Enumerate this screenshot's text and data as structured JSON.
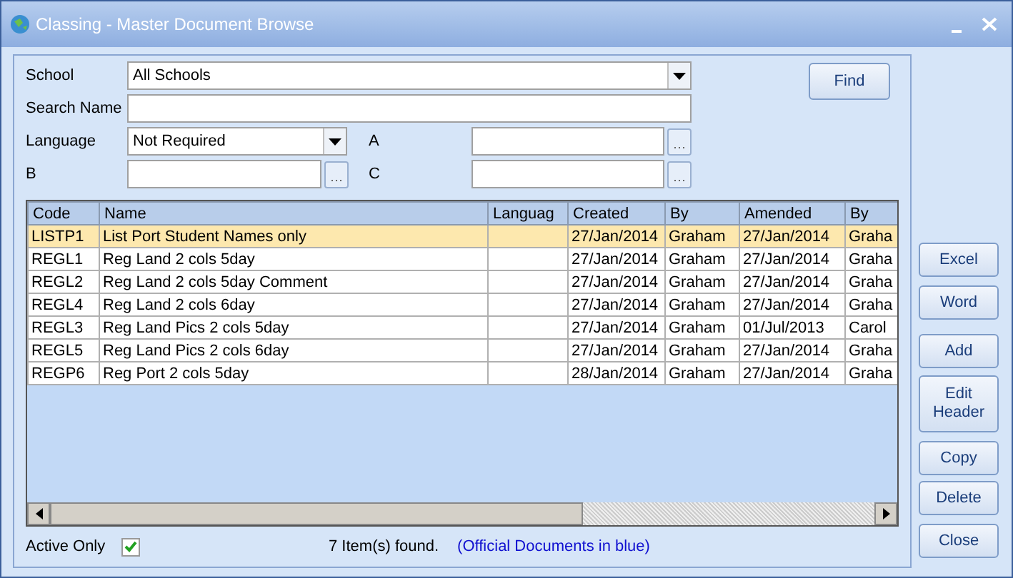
{
  "window": {
    "title": "Classing - Master Document Browse"
  },
  "filters": [
    {
      "kind": "dropdown",
      "label": "School",
      "value": "All Schools"
    },
    {
      "kind": "text",
      "label": "Search Name"
    },
    {
      "kind": "dropdown",
      "label": "Language",
      "value": "Not Required"
    },
    {
      "kind": "lookup",
      "label": "A"
    },
    {
      "kind": "lookup",
      "label": "B"
    },
    {
      "kind": "lookup",
      "label": "C"
    }
  ],
  "find_button": "Find",
  "table": {
    "columns": [
      "Code",
      "Name",
      "Languag",
      "Created",
      "By",
      "Amended",
      "By"
    ],
    "rows": [
      {
        "selected": true,
        "cells": [
          "LISTP1",
          "List Port Student Names only",
          "",
          "27/Jan/2014",
          "Graham",
          "27/Jan/2014",
          "Graha"
        ]
      },
      {
        "selected": false,
        "cells": [
          "REGL1",
          "Reg Land 2 cols 5day",
          "",
          "27/Jan/2014",
          "Graham",
          "27/Jan/2014",
          "Graha"
        ]
      },
      {
        "selected": false,
        "cells": [
          "REGL2",
          "Reg Land 2 cols 5day Comment",
          "",
          "27/Jan/2014",
          "Graham",
          "27/Jan/2014",
          "Graha"
        ]
      },
      {
        "selected": false,
        "cells": [
          "REGL4",
          "Reg Land 2 cols 6day",
          "",
          "27/Jan/2014",
          "Graham",
          "27/Jan/2014",
          "Graha"
        ]
      },
      {
        "selected": false,
        "cells": [
          "REGL3",
          "Reg Land Pics 2 cols 5day",
          "",
          "27/Jan/2014",
          "Graham",
          "01/Jul/2013",
          "Carol"
        ]
      },
      {
        "selected": false,
        "cells": [
          "REGL5",
          "Reg Land Pics 2 cols 6day",
          "",
          "27/Jan/2014",
          "Graham",
          "27/Jan/2014",
          "Graha"
        ]
      },
      {
        "selected": false,
        "cells": [
          "REGP6",
          "Reg Port 2 cols 5day",
          "",
          "28/Jan/2014",
          "Graham",
          "27/Jan/2014",
          "Graha"
        ]
      }
    ]
  },
  "active_only": {
    "label": "Active Only",
    "checked": true
  },
  "status": "7 Item(s) found.",
  "note": "(Official Documents in blue)",
  "buttons": [
    "Excel",
    "Word",
    "Add",
    "Edit Header",
    "Copy",
    "Delete",
    "Close"
  ]
}
